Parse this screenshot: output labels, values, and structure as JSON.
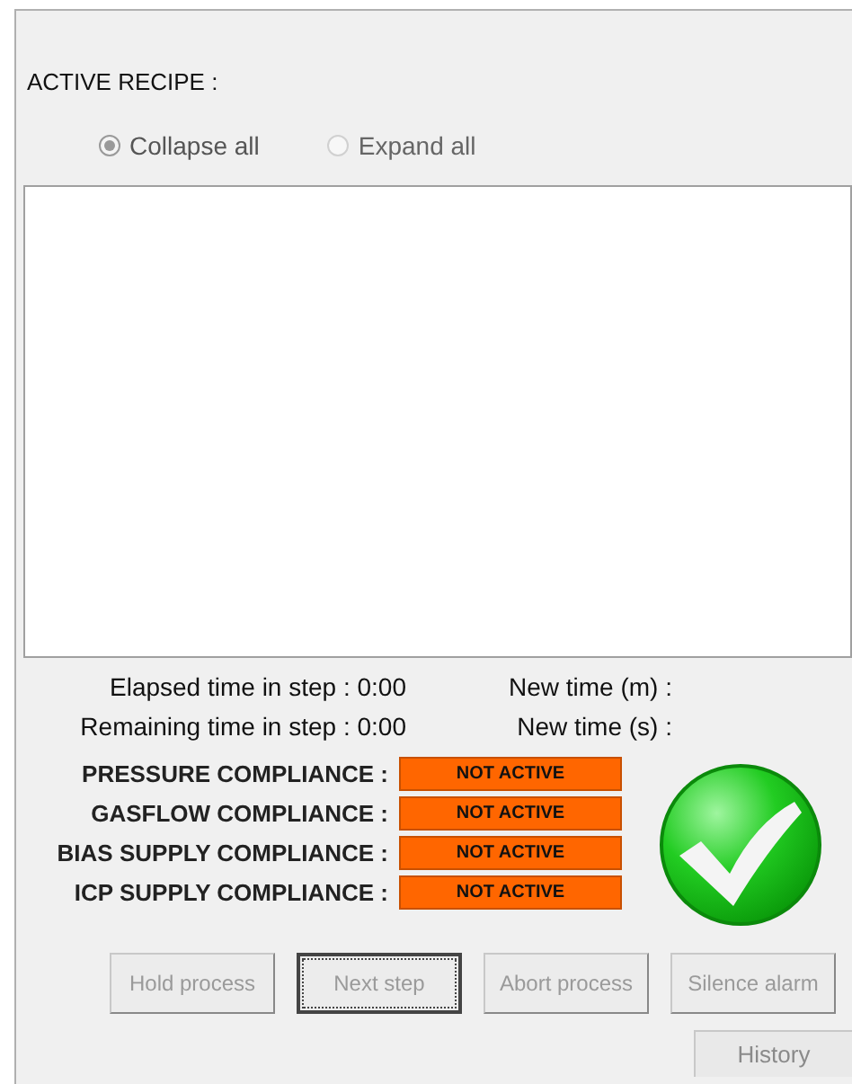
{
  "recipe_label": "ACTIVE RECIPE :",
  "view_options": [
    {
      "label": "Collapse all",
      "selected": true
    },
    {
      "label": "Expand all",
      "selected": false
    }
  ],
  "times": [
    {
      "label": "Elapsed time in step : 0:00",
      "new_time": "New time (m) :"
    },
    {
      "label": "Remaining time in step : 0:00",
      "new_time": "New time (s) :"
    }
  ],
  "compliance": [
    {
      "label": "PRESSURE COMPLIANCE :",
      "status": "NOT ACTIVE"
    },
    {
      "label": "GASFLOW COMPLIANCE :",
      "status": "NOT ACTIVE"
    },
    {
      "label": "BIAS SUPPLY COMPLIANCE :",
      "status": "NOT ACTIVE"
    },
    {
      "label": "ICP SUPPLY COMPLIANCE :",
      "status": "NOT ACTIVE"
    }
  ],
  "status_indicator": {
    "kind": "ok"
  },
  "buttons": [
    {
      "label": "Hold process",
      "disabled": true,
      "focused": false
    },
    {
      "label": "Next step",
      "disabled": true,
      "focused": true
    },
    {
      "label": "Abort process",
      "disabled": true,
      "focused": false
    },
    {
      "label": "Silence alarm",
      "disabled": true,
      "focused": false
    }
  ],
  "history_button": {
    "label": "History",
    "disabled": true
  }
}
